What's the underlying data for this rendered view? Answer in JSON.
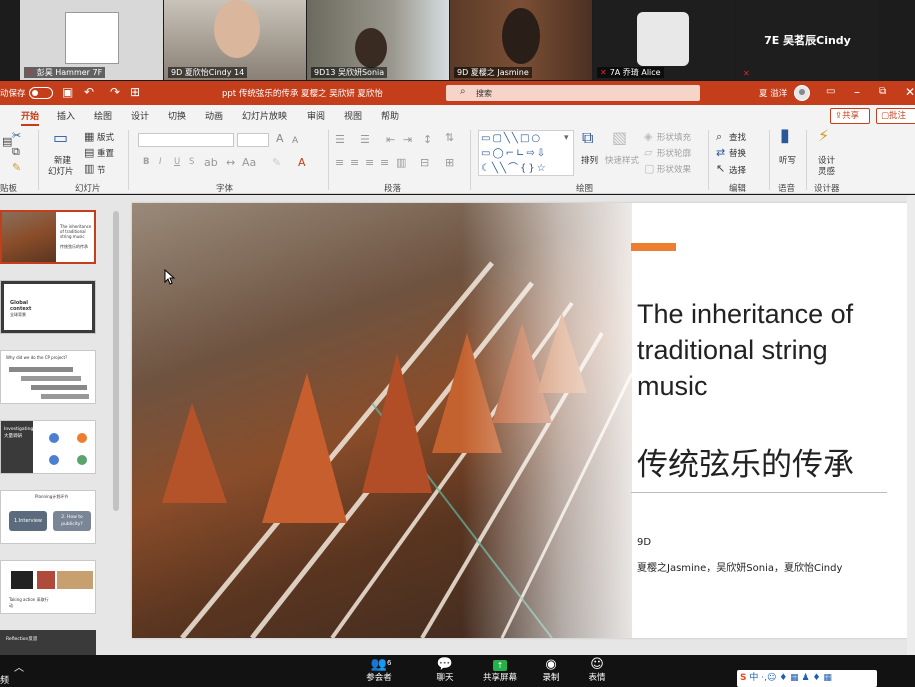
{
  "gallery": {
    "tiles": [
      {
        "name": "彭昊 Hammer 7F"
      },
      {
        "name": "9D 夏欣怡Cindy 14"
      },
      {
        "name": "9D13 吴欣妍Sonia"
      },
      {
        "name": "9D 夏樱之 Jasmine"
      },
      {
        "name": "7A 乔琦  Alice"
      },
      {
        "name": "",
        "center_label": "7E 吴茗辰Cindy"
      }
    ]
  },
  "titlebar": {
    "autosave": "动保存",
    "autosave_state": "关",
    "document_title": "ppt 传统弦乐的传承 夏樱之 吴欣妍 夏欣怡",
    "search_placeholder": "搜索",
    "user_name": "夏 溢洋",
    "accent_color": "#c43e1c"
  },
  "ribbon_tabs": [
    "开始",
    "插入",
    "绘图",
    "设计",
    "切换",
    "动画",
    "幻灯片放映",
    "审阅",
    "视图",
    "帮助"
  ],
  "active_tab": "开始",
  "share_label": "共享",
  "comment_label": "批注",
  "ribbon": {
    "groups": {
      "clipboard": "贴板",
      "slides": "幻灯片",
      "font": "字体",
      "paragraph": "段落",
      "drawing": "绘图",
      "editing": "编辑",
      "voice": "语音",
      "designer": "设计器"
    },
    "slides_group": {
      "new_slide_1": "新建",
      "new_slide_2": "幻灯片",
      "layout": "版式",
      "reset": "重置",
      "section": "节"
    },
    "drawing_group": {
      "arrange": "排列",
      "quick_styles": "快速样式",
      "shape_fill": "形状填充",
      "shape_outline": "形状轮廓",
      "shape_effects": "形状效果"
    },
    "editing_group": {
      "find": "查找",
      "replace": "替换",
      "select": "选择"
    },
    "dictate": "听写",
    "designer_1": "设计",
    "designer_2": "灵感",
    "font_buttons": [
      "B",
      "I",
      "U",
      "S"
    ]
  },
  "thumbnails": [
    {
      "title": "The inheritance of traditional string music",
      "subtitle": "传统弦乐的传承"
    },
    {
      "title": "Global context",
      "subtitle": "全球背景"
    },
    {
      "title": "Why did we do the CP project?",
      "subtitle": ""
    },
    {
      "title": "Investigating",
      "subtitle": "大量调研"
    },
    {
      "title": "Planning计划环节",
      "subtitle": ""
    },
    {
      "title": "Taking action 采取行动",
      "subtitle": ""
    },
    {
      "title": "Reflection反思",
      "subtitle": ""
    }
  ],
  "thumbnail_labels": {
    "interview": "1.Interview",
    "publicity": "2. How to publicity?"
  },
  "slide": {
    "title_en": "The inheritance of traditional string music",
    "title_zh": "传统弦乐的传承",
    "class": "9D",
    "authors": "夏樱之Jasmine，吴欣妍Sonia，夏欣怡Cindy",
    "accent": "#ed7d31"
  },
  "zoom_toolbar": {
    "participants": "参会者",
    "participants_count": "6",
    "chat": "聊天",
    "share_screen": "共享屏幕",
    "record": "录制",
    "reactions": "表情",
    "left_label": "频"
  },
  "ime": "中"
}
